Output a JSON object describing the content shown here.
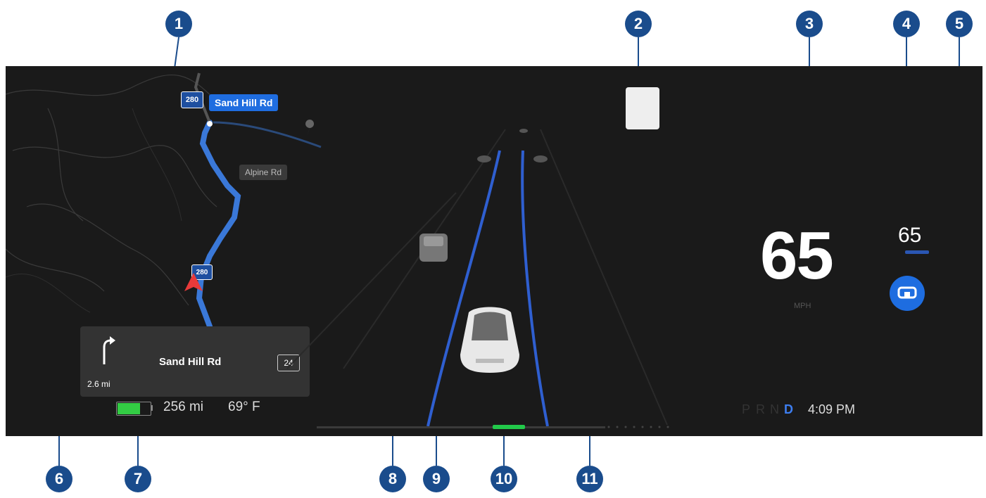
{
  "callouts": [
    "1",
    "2",
    "3",
    "4",
    "5",
    "6",
    "7",
    "8",
    "9",
    "10",
    "11"
  ],
  "map": {
    "highway_top": "280",
    "highway_bottom": "280",
    "current_road_label": "Sand Hill Rd",
    "side_road_label": "Alpine Rd"
  },
  "turn_card": {
    "street": "Sand Hill Rd",
    "distance": "2.6 mi",
    "route_shield": "24",
    "arrow_icon": "turn-right-icon"
  },
  "status": {
    "battery_level": 0.7,
    "range": "256 mi",
    "temperature": "69° F"
  },
  "driving": {
    "speed": "65",
    "speed_unit": "MPH",
    "speed_limit": "65",
    "gears": [
      "P",
      "R",
      "N"
    ],
    "active_gear": "D",
    "time": "4:09 PM"
  },
  "colors": {
    "callout": "#1a4c8c",
    "route": "#3a78d8",
    "autopilot": "#1e6de0",
    "battery": "#33cc44"
  }
}
